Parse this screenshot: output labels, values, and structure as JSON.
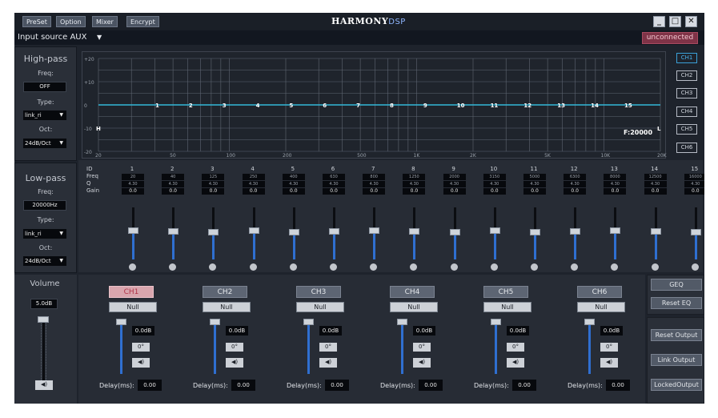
{
  "titlebar": {
    "menu": [
      "PreSet",
      "Option",
      "Mixer",
      "Encrypt"
    ],
    "brand": "HARMONY",
    "brand_suffix": "DSP",
    "window_buttons": [
      "minimize-icon",
      "maximize-icon",
      "close-icon"
    ]
  },
  "source": {
    "label": "Input source",
    "value": "AUX",
    "status": "unconnected"
  },
  "highpass": {
    "title": "High-pass",
    "freq_label": "Freq:",
    "freq_value": "OFF",
    "type_label": "Type:",
    "type_value": "link_ri",
    "oct_label": "Oct:",
    "oct_value": "24dB/Oct"
  },
  "lowpass": {
    "title": "Low-pass",
    "freq_label": "Freq:",
    "freq_value": "20000Hz",
    "type_label": "Type:",
    "type_value": "link_ri",
    "oct_label": "Oct:",
    "oct_value": "24dB/Oct"
  },
  "graph": {
    "y_ticks": [
      "+20",
      "+10",
      "0",
      "-10",
      "-20"
    ],
    "x_ticks": [
      "20",
      "50",
      "100",
      "200",
      "500",
      "1K",
      "2K",
      "5K",
      "10K",
      "20K"
    ],
    "band_markers": [
      "1",
      "2",
      "3",
      "4",
      "5",
      "6",
      "7",
      "8",
      "9",
      "10",
      "11",
      "12",
      "13",
      "14",
      "15"
    ],
    "h_marker": "H",
    "l_marker": "L",
    "freq_readout": "F:20000",
    "channel_buttons": [
      "CH1",
      "CH2",
      "CH3",
      "CH4",
      "CH5",
      "CH6"
    ]
  },
  "eq": {
    "row_labels": [
      "ID",
      "Freq",
      "Q",
      "Gain"
    ],
    "bands": [
      {
        "id": "1",
        "freq": "20",
        "q": "4.30",
        "gain": "0.0"
      },
      {
        "id": "2",
        "freq": "40",
        "q": "4.30",
        "gain": "0.0"
      },
      {
        "id": "3",
        "freq": "125",
        "q": "4.30",
        "gain": "0.0"
      },
      {
        "id": "4",
        "freq": "250",
        "q": "4.30",
        "gain": "0.0"
      },
      {
        "id": "5",
        "freq": "400",
        "q": "4.30",
        "gain": "0.0"
      },
      {
        "id": "6",
        "freq": "630",
        "q": "4.30",
        "gain": "0.0"
      },
      {
        "id": "7",
        "freq": "800",
        "q": "4.30",
        "gain": "0.0"
      },
      {
        "id": "8",
        "freq": "1250",
        "q": "4.30",
        "gain": "0.0"
      },
      {
        "id": "9",
        "freq": "2000",
        "q": "4.30",
        "gain": "0.0"
      },
      {
        "id": "10",
        "freq": "3150",
        "q": "4.30",
        "gain": "0.0"
      },
      {
        "id": "11",
        "freq": "5000",
        "q": "4.30",
        "gain": "0.0"
      },
      {
        "id": "12",
        "freq": "6300",
        "q": "4.30",
        "gain": "0.0"
      },
      {
        "id": "13",
        "freq": "8000",
        "q": "4.30",
        "gain": "0.0"
      },
      {
        "id": "14",
        "freq": "12500",
        "q": "4.30",
        "gain": "0.0"
      },
      {
        "id": "15",
        "freq": "16000",
        "q": "4.30",
        "gain": "0.0"
      }
    ],
    "geq_label": "GEQ",
    "reset_eq_label": "Reset EQ"
  },
  "volume": {
    "title": "Volume",
    "value": "5.0dB",
    "mute_icon": "speaker-icon"
  },
  "outputs": [
    {
      "name": "CH1",
      "mode": "Null",
      "gain": "0.0dB",
      "phase": "0°",
      "delay_label": "Delay(ms):",
      "delay": "0.00"
    },
    {
      "name": "CH2",
      "mode": "Null",
      "gain": "0.0dB",
      "phase": "0°",
      "delay_label": "Delay(ms):",
      "delay": "0.00"
    },
    {
      "name": "CH3",
      "mode": "Null",
      "gain": "0.0dB",
      "phase": "0°",
      "delay_label": "Delay(ms):",
      "delay": "0.00"
    },
    {
      "name": "CH4",
      "mode": "Null",
      "gain": "0.0dB",
      "phase": "0°",
      "delay_label": "Delay(ms):",
      "delay": "0.00"
    },
    {
      "name": "CH5",
      "mode": "Null",
      "gain": "0.0dB",
      "phase": "0°",
      "delay_label": "Delay(ms):",
      "delay": "0.00"
    },
    {
      "name": "CH6",
      "mode": "Null",
      "gain": "0.0dB",
      "phase": "0°",
      "delay_label": "Delay(ms):",
      "delay": "0.00"
    }
  ],
  "right_buttons": {
    "reset_output": "Reset Output",
    "link_output": "Link Output",
    "locked_output": "LockedOutput"
  },
  "colors": {
    "curve": "#33b8d8",
    "accent": "#2f6fd0",
    "selected_channel": "#d9a6ae"
  }
}
